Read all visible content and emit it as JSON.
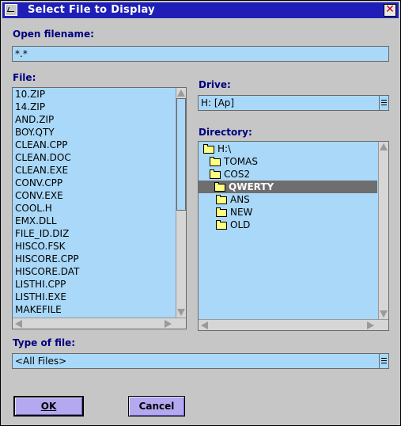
{
  "window": {
    "title": "Select File to Display",
    "close_glyph": "✕"
  },
  "open_filename": {
    "label": "Open filename:",
    "value": "*.*"
  },
  "file_list": {
    "label": "File:",
    "items": [
      "10.ZIP",
      "14.ZIP",
      "AND.ZIP",
      "BOY.QTY",
      "CLEAN.CPP",
      "CLEAN.DOC",
      "CLEAN.EXE",
      "CONV.CPP",
      "CONV.EXE",
      "COOL.H",
      "EMX.DLL",
      "FILE_ID.DIZ",
      "HISCO.FSK",
      "HISCORE.CPP",
      "HISCORE.DAT",
      "LISTHI.CPP",
      "LISTHI.EXE",
      "MAKEFILE"
    ]
  },
  "drive": {
    "label": "Drive:",
    "value": "H:  [Ap]"
  },
  "directory": {
    "label": "Directory:",
    "items": [
      {
        "name": "H:\\",
        "icon": "open-folder-icon",
        "selected": false
      },
      {
        "name": "TOMAS",
        "icon": "open-folder-icon",
        "selected": false
      },
      {
        "name": "COS2",
        "icon": "open-folder-icon",
        "selected": false
      },
      {
        "name": "QWERTY",
        "icon": "open-folder-icon",
        "selected": true
      },
      {
        "name": "ANS",
        "icon": "folder-icon",
        "selected": false
      },
      {
        "name": "NEW",
        "icon": "folder-icon",
        "selected": false
      },
      {
        "name": "OLD",
        "icon": "folder-icon",
        "selected": false
      }
    ]
  },
  "type_of_file": {
    "label": "Type of file:",
    "value": "<All Files>"
  },
  "buttons": {
    "ok": "OK",
    "cancel": "Cancel"
  },
  "colors": {
    "titlebar": "#1f1fb8",
    "field": "#a9d8f8",
    "label": "#000080",
    "button": "#b4a8f0",
    "selected_row": "#6e6e6e"
  }
}
